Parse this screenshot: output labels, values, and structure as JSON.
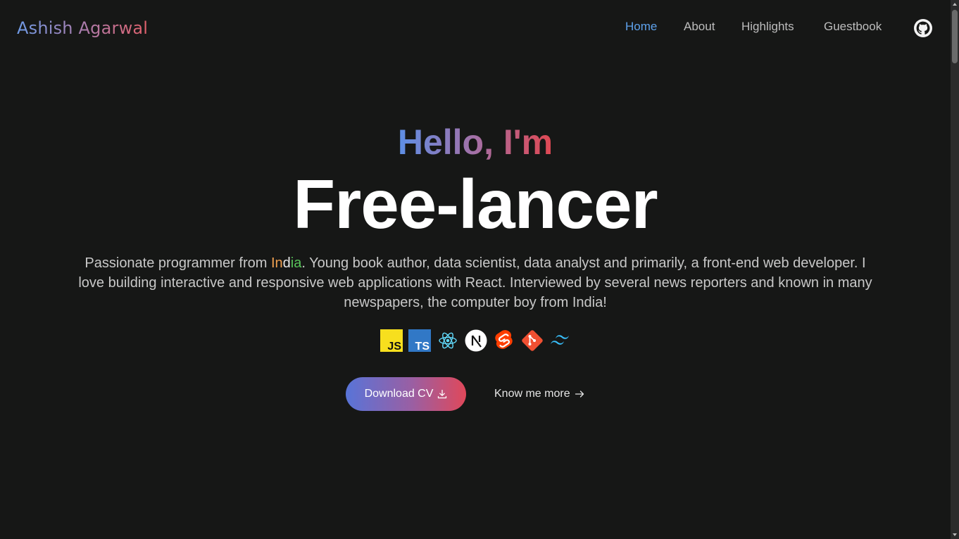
{
  "header": {
    "brand": "Ashish Agarwal",
    "nav": [
      {
        "label": "Home",
        "active": true
      },
      {
        "label": "About",
        "active": false
      },
      {
        "label": "Highlights",
        "active": false
      },
      {
        "label": "Guestbook",
        "active": false
      }
    ],
    "github_icon": "github-icon"
  },
  "hero": {
    "greeting": "Hello, I'm",
    "title": "Free-lancer",
    "description": {
      "prefix": "Passionate programmer from ",
      "country_part1": "In",
      "country_part2": "d",
      "country_part3": "ia",
      "suffix": ". Young book author, data scientist, data analyst and primarily, a front-end web developer. I love building interactive and responsive web applications with React. Interviewed by several news reporters and known in many newspapers, the computer boy from India!"
    },
    "tech_icons": [
      "javascript-icon",
      "typescript-icon",
      "react-icon",
      "nextjs-icon",
      "svelte-icon",
      "git-icon",
      "tailwind-icon"
    ],
    "primary_button": "Download CV",
    "secondary_button": "Know me more"
  },
  "colors": {
    "background": "#161716",
    "nav_active": "#5ea2ec",
    "gradient_start": "#5d8fe6",
    "gradient_end": "#e04852"
  }
}
